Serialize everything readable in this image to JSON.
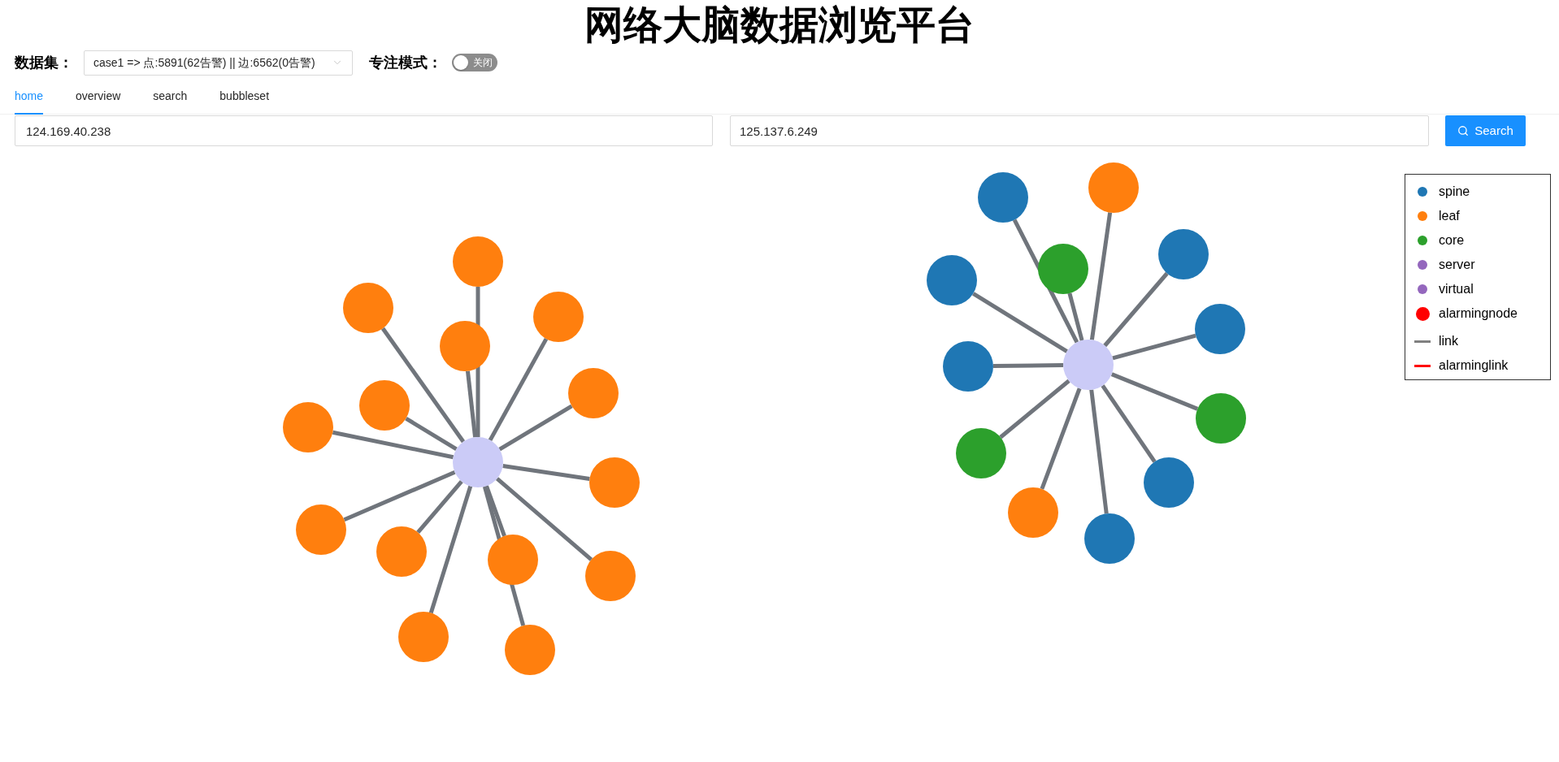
{
  "title": "网络大脑数据浏览平台",
  "dataset": {
    "label": "数据集：",
    "value": "case1 => 点:5891(62告警) || 边:6562(0告警)"
  },
  "focus_mode": {
    "label": "专注模式：",
    "on": false,
    "text": "关闭"
  },
  "tabs": [
    {
      "label": "home",
      "selected": true
    },
    {
      "label": "overview",
      "selected": false
    },
    {
      "label": "search",
      "selected": false
    },
    {
      "label": "bubbleset",
      "selected": false
    }
  ],
  "search": {
    "fields": [
      {
        "value": "124.169.40.238"
      },
      {
        "value": "125.137.6.249"
      }
    ],
    "button": "Search"
  },
  "graphs": [
    {
      "hub": {
        "color": "#cbcbf7"
      },
      "nodes": [
        {
          "color": "#ff7f0e"
        },
        {
          "color": "#ff7f0e"
        },
        {
          "color": "#ff7f0e"
        },
        {
          "color": "#ff7f0e"
        },
        {
          "color": "#ff7f0e"
        },
        {
          "color": "#ff7f0e"
        },
        {
          "color": "#ff7f0e"
        },
        {
          "color": "#ff7f0e"
        },
        {
          "color": "#ff7f0e"
        },
        {
          "color": "#ff7f0e"
        },
        {
          "color": "#ff7f0e"
        },
        {
          "color": "#ff7f0e"
        },
        {
          "color": "#ff7f0e"
        },
        {
          "color": "#ff7f0e"
        }
      ]
    },
    {
      "hub": {
        "color": "#cbcbf7"
      },
      "nodes": [
        {
          "color": "#ff7f0e"
        },
        {
          "color": "#1f77b4"
        },
        {
          "color": "#1f77b4"
        },
        {
          "color": "#2ca02c"
        },
        {
          "color": "#1f77b4"
        },
        {
          "color": "#1f77b4"
        },
        {
          "color": "#1f77b4"
        },
        {
          "color": "#2ca02c"
        },
        {
          "color": "#2ca02c"
        },
        {
          "color": "#1f77b4"
        },
        {
          "color": "#ff7f0e"
        },
        {
          "color": "#1f77b4"
        }
      ]
    }
  ],
  "legend": [
    {
      "kind": "dot",
      "label": "spine",
      "color": "#1f77b4"
    },
    {
      "kind": "dot",
      "label": "leaf",
      "color": "#ff7f0e"
    },
    {
      "kind": "dot",
      "label": "core",
      "color": "#2ca02c"
    },
    {
      "kind": "dot",
      "label": "server",
      "color": "#9467bd"
    },
    {
      "kind": "dot",
      "label": "virtual",
      "color": "#9467bd"
    },
    {
      "kind": "big-dot",
      "label": "alarmingnode",
      "color": "#ff0000"
    },
    {
      "kind": "line",
      "label": "link",
      "color": "#808080"
    },
    {
      "kind": "line",
      "label": "alarminglink",
      "color": "#ff0000"
    }
  ]
}
